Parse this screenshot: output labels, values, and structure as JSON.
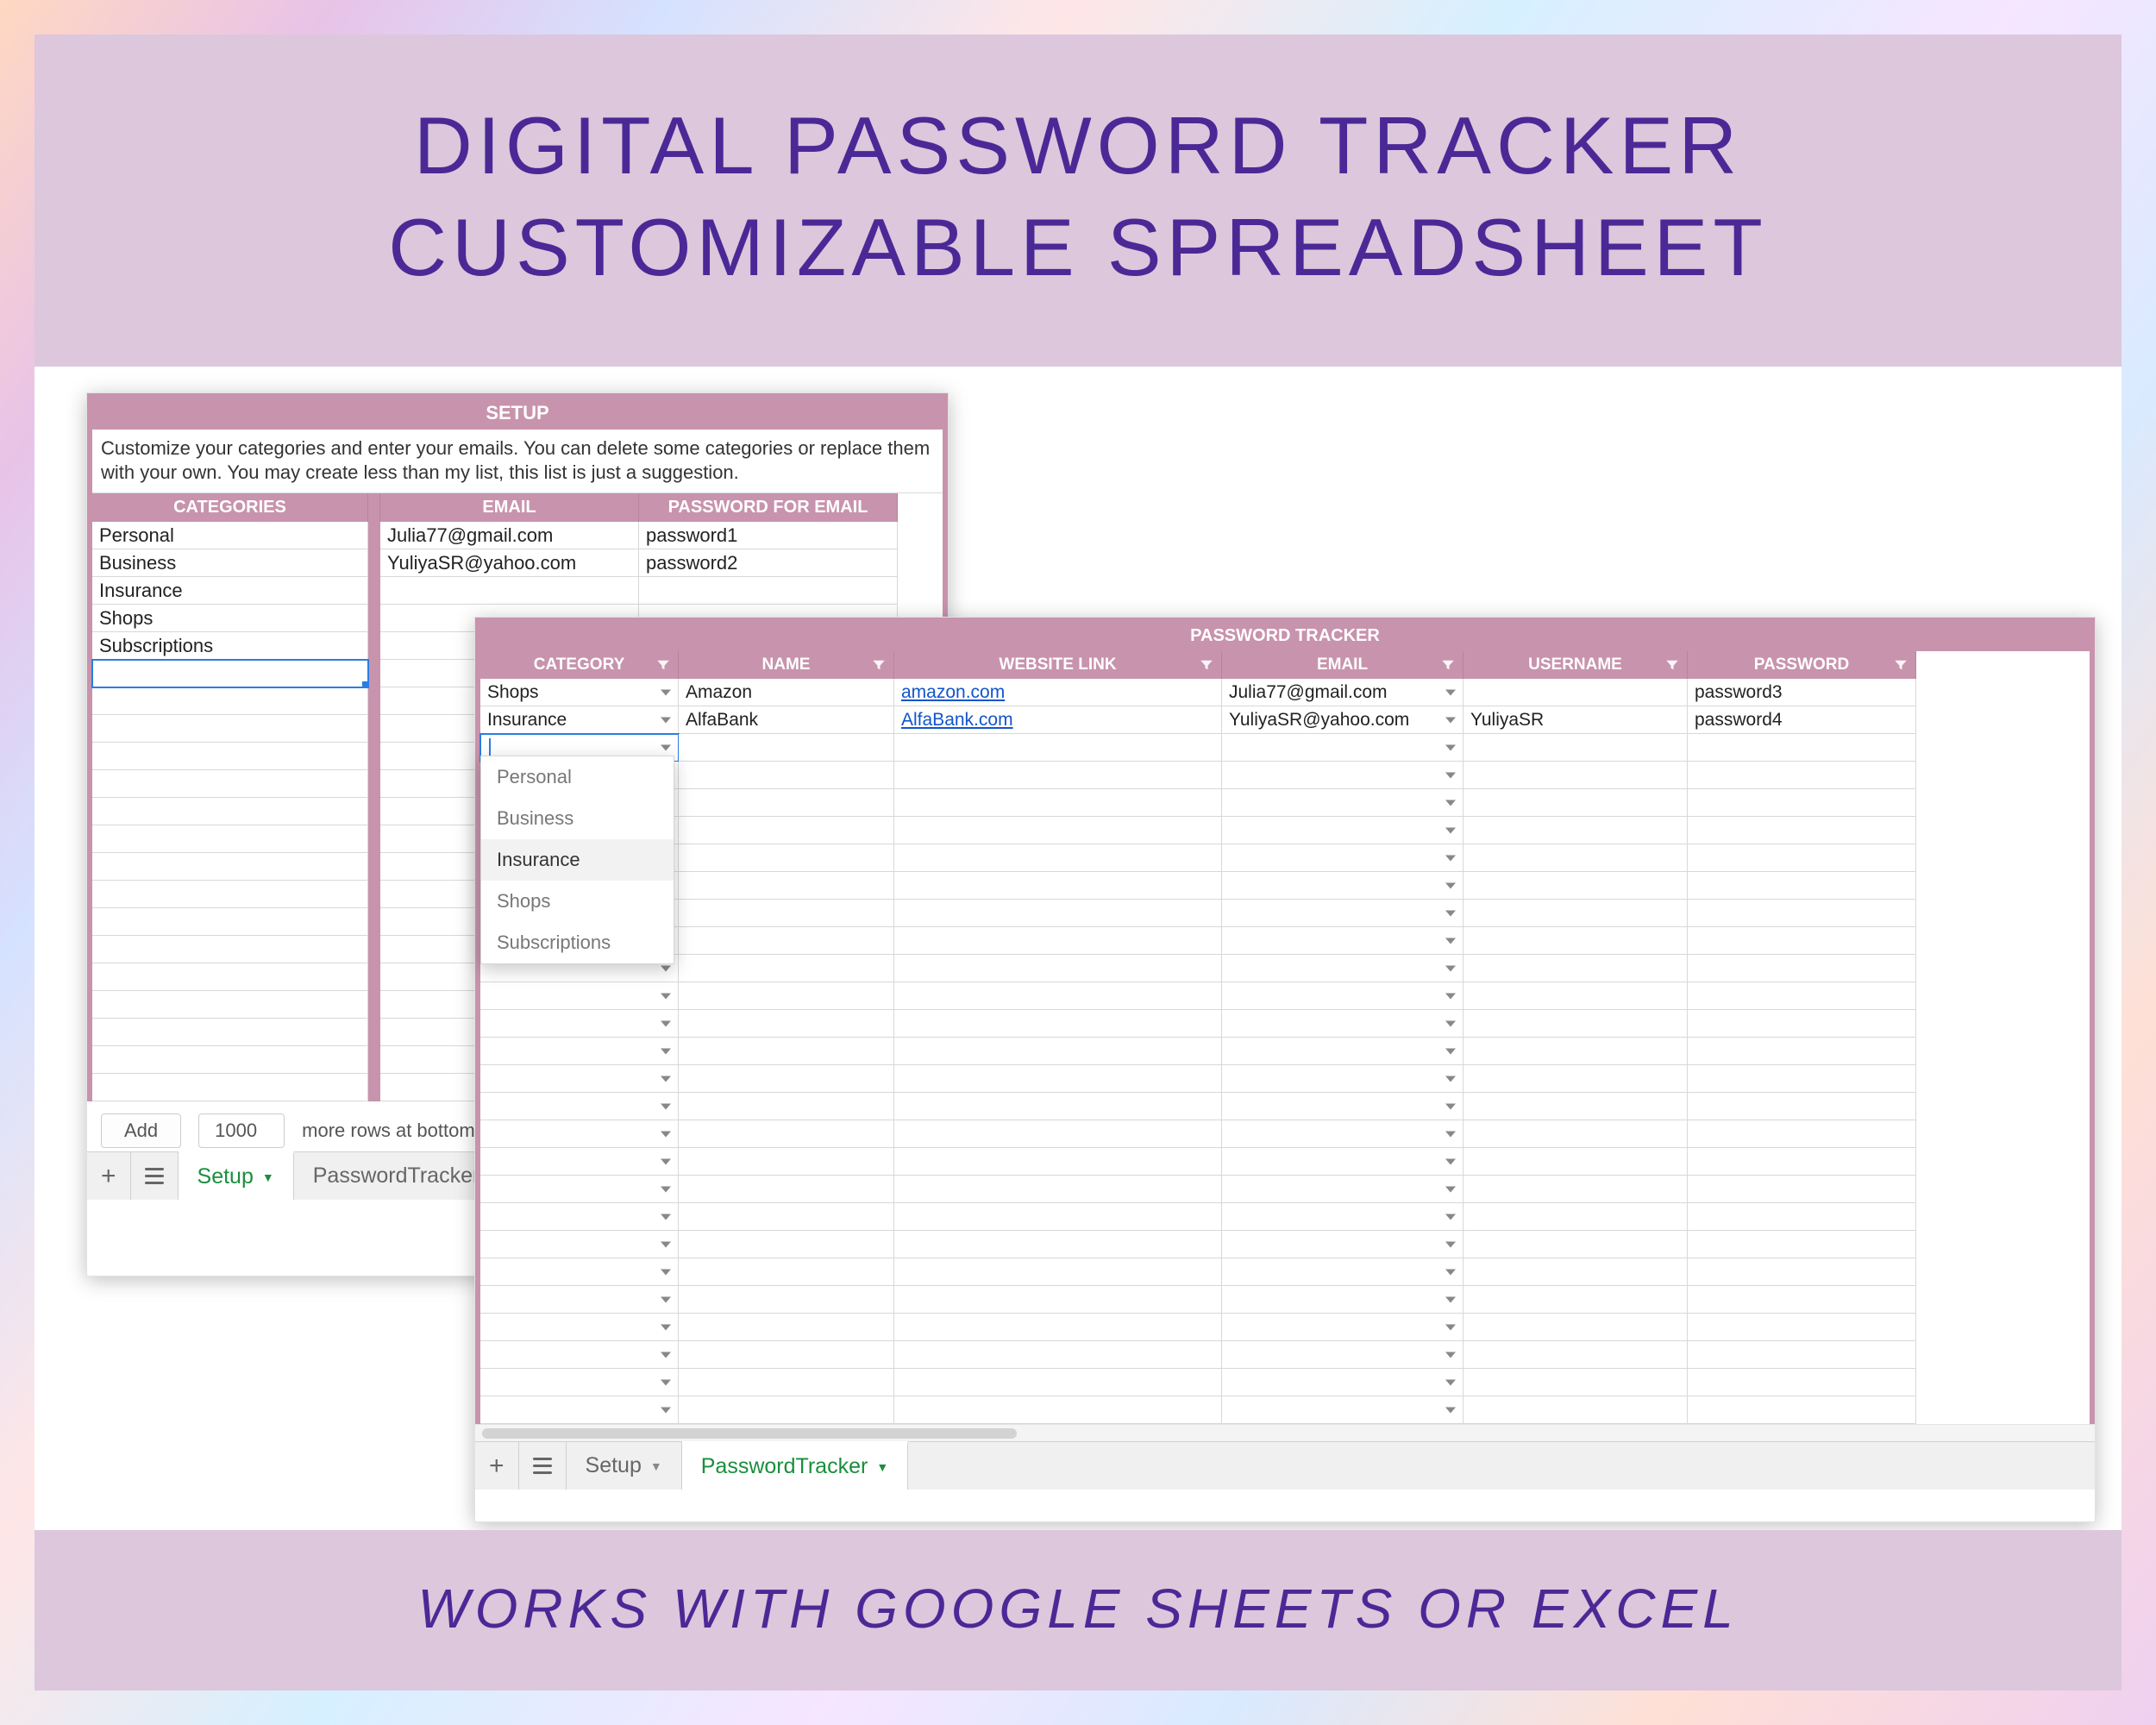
{
  "headline": {
    "line1": "DIGITAL PASSWORD TRACKER",
    "line2": "CUSTOMIZABLE SPREADSHEET"
  },
  "footer_line": "WORKS WITH GOOGLE SHEETS OR EXCEL",
  "setup_window": {
    "title": "SETUP",
    "description": "Customize your categories and enter your emails. You can delete some categories or replace them with your own. You may create less than my list, this list is just a suggestion.",
    "headers": {
      "categories": "CATEGORIES",
      "email": "EMAIL",
      "password_for_email": "PASSWORD FOR EMAIL"
    },
    "categories": [
      "Personal",
      "Business",
      "Insurance",
      "Shops",
      "Subscriptions"
    ],
    "emails": [
      {
        "email": "Julia77@gmail.com",
        "password": "password1"
      },
      {
        "email": "YuliyaSR@yahoo.com",
        "password": "password2"
      }
    ],
    "add_rows": {
      "button_label": "Add",
      "count": "1000",
      "suffix": "more rows at bottom"
    },
    "tabs": {
      "setup": "Setup",
      "password_tracker": "PasswordTracker"
    }
  },
  "tracker_window": {
    "title": "PASSWORD TRACKER",
    "headers": {
      "category": "CATEGORY",
      "name": "NAME",
      "website_link": "WEBSITE LINK",
      "email": "EMAIL",
      "username": "USERNAME",
      "password": "PASSWORD"
    },
    "rows": [
      {
        "category": "Shops",
        "name": "Amazon",
        "website": "amazon.com",
        "email": "Julia77@gmail.com",
        "username": "",
        "password": "password3"
      },
      {
        "category": "Insurance",
        "name": "AlfaBank",
        "website": "AlfaBank.com",
        "email": "YuliyaSR@yahoo.com",
        "username": "YuliyaSR",
        "password": "password4"
      }
    ],
    "dropdown_options": [
      "Personal",
      "Business",
      "Insurance",
      "Shops",
      "Subscriptions"
    ],
    "tabs": {
      "setup": "Setup",
      "password_tracker": "PasswordTracker"
    }
  }
}
